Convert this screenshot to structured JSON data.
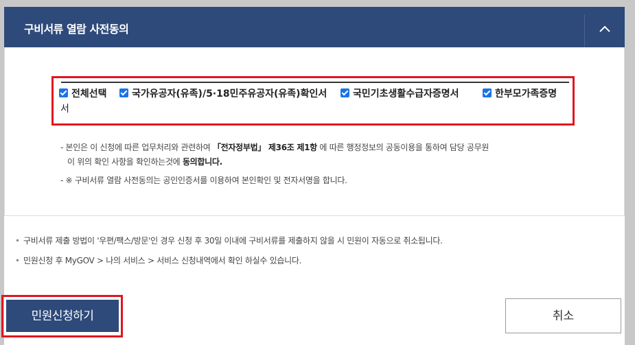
{
  "header": {
    "title": "구비서류 열람 사전동의"
  },
  "consent": {
    "checkboxes": [
      {
        "label": "전체선택",
        "checked": true
      },
      {
        "label": "국가유공자(유족)/5·18민주유공자(유족)확인서",
        "checked": true
      },
      {
        "label": "국민기초생활수급자증명서",
        "checked": true
      },
      {
        "label": "한부모가족증명",
        "checked": true
      }
    ],
    "wrap_text": "서"
  },
  "notes": {
    "line1_pre": "- 본인은 이 신청에 따른 업무처리와 관련하여 ",
    "line1_bold": "「전자정부법」 제36조 제1항",
    "line1_post": " 에 따른 행정정보의 공동이용을 통하여 담당 공무원",
    "line2_pre": "이 위의 확인 사항을 확인하는것에 ",
    "line2_bold": "동의합니다.",
    "line3": "- ※ 구비서류 열람 사전동의는 공인인증서를 이용하여 본인확인 및 전자서명을 합니다."
  },
  "footer": {
    "note1": "구비서류 제출 방법이 '우편/팩스/방문'인 경우 신청 후 30일 이내에 구비서류를 제출하지 않을 시 민원이 자동으로 취소됩니다.",
    "note2": "민원신청 후 MyGOV > 나의 서비스 > 서비스 신청내역에서 확인 하실수 있습니다."
  },
  "actions": {
    "apply_label": "민원신청하기",
    "cancel_label": "취소"
  },
  "colors": {
    "header_bg": "#2e4a7a",
    "highlight": "#e0161f",
    "checkbox": "#1a73e8"
  },
  "icons": {
    "collapse": "chevron-up-icon"
  }
}
